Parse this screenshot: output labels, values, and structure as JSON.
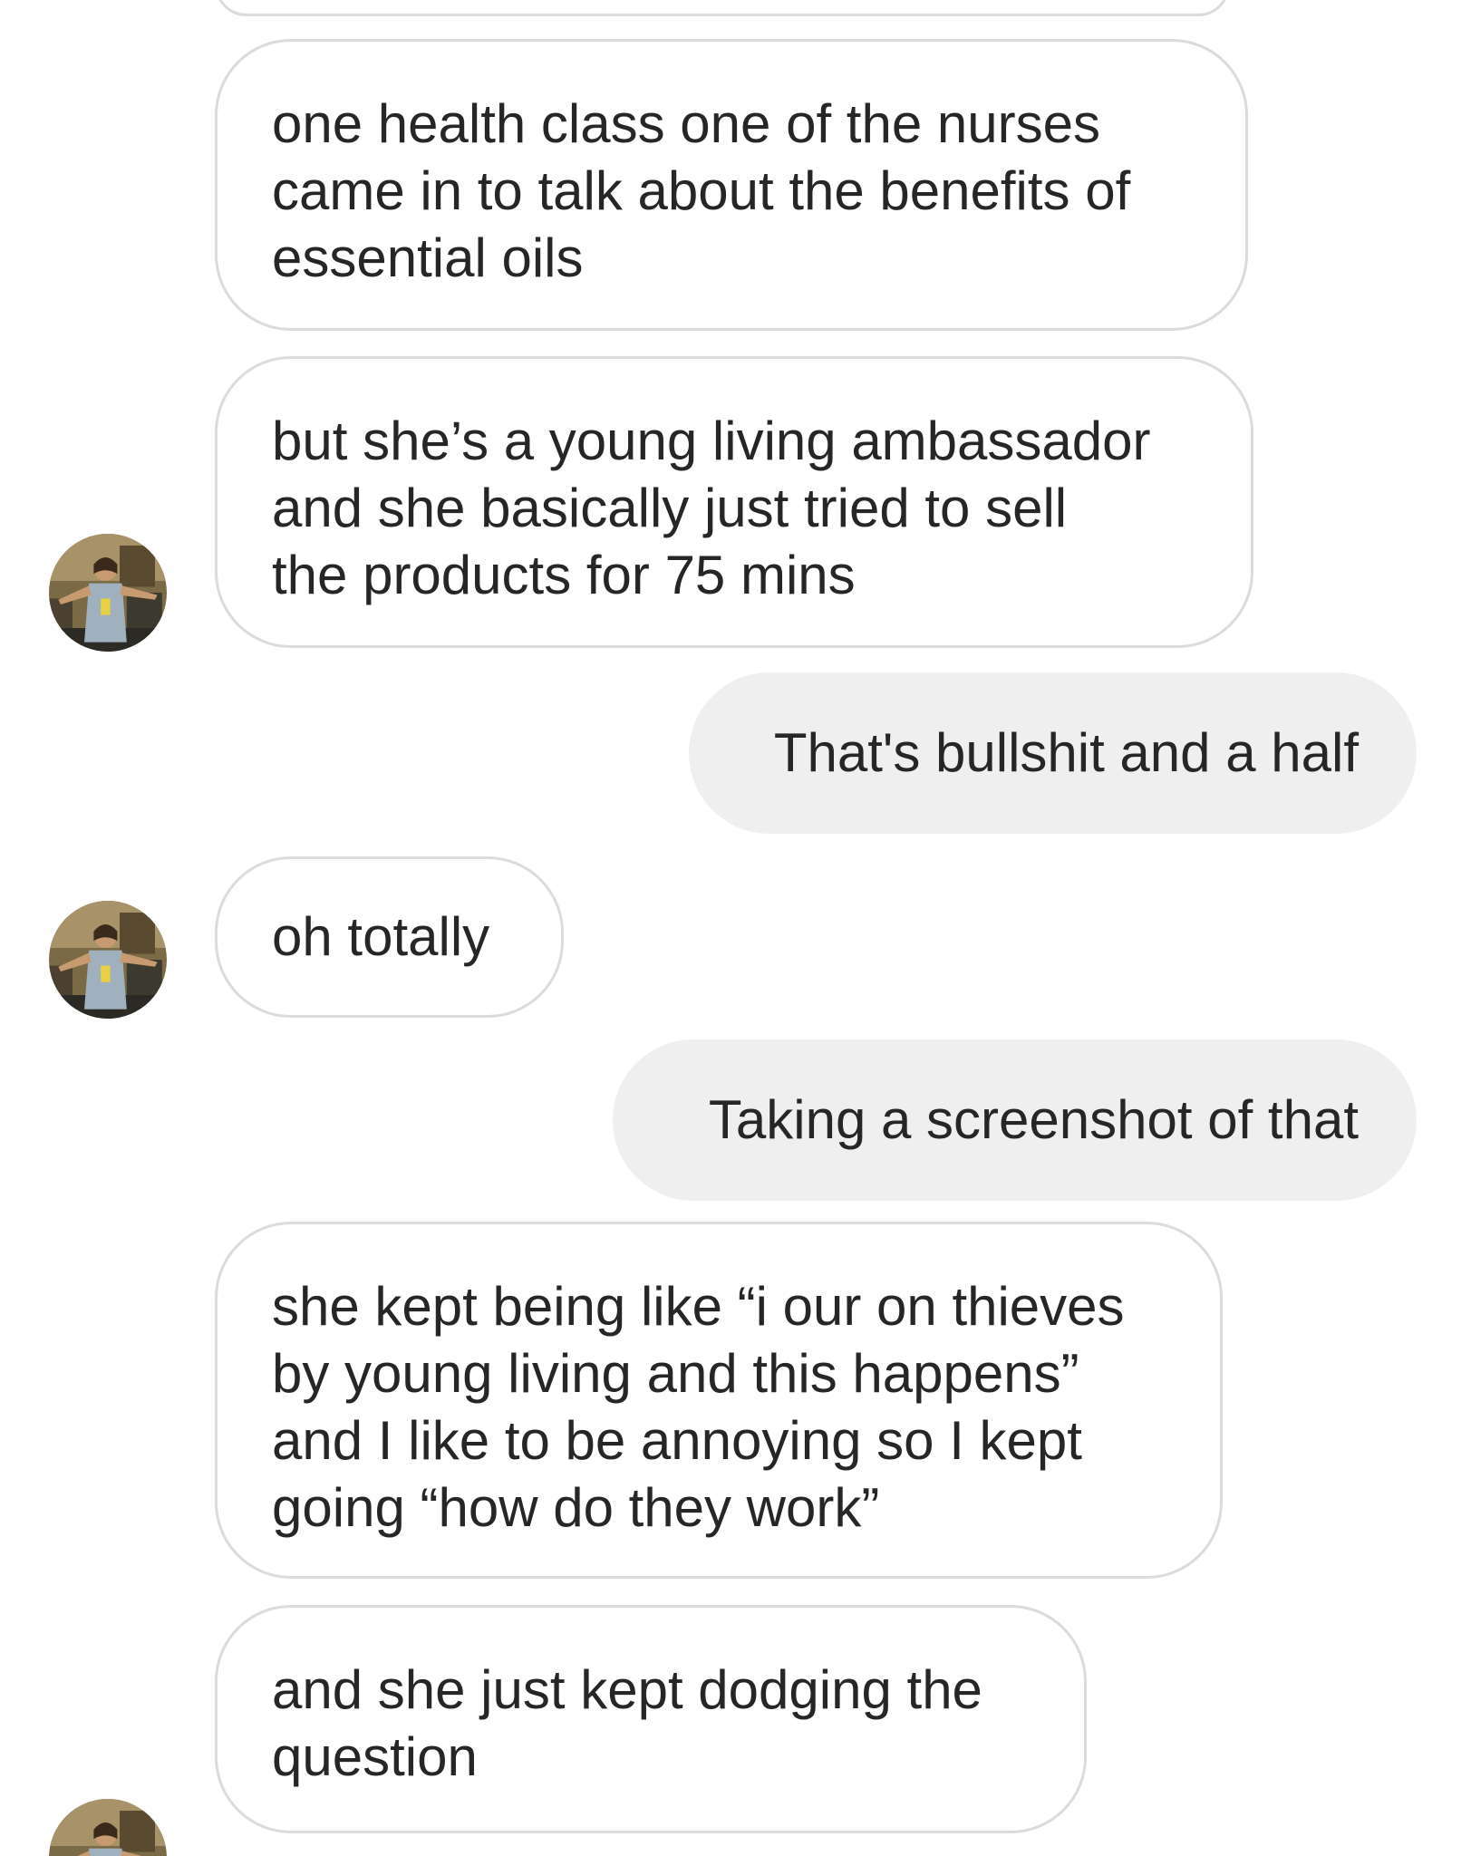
{
  "messages": [
    {
      "sender": "them",
      "text": "one health class one of the nurses\ncame in to talk about the benefits of\nessential oils"
    },
    {
      "sender": "them",
      "text": "but she’s a young living ambassador\nand she basically just tried to sell\nthe products for 75 mins"
    },
    {
      "sender": "me",
      "text": "That's bullshit and a half"
    },
    {
      "sender": "them",
      "text": "oh totally"
    },
    {
      "sender": "me",
      "text": "Taking a screenshot of that"
    },
    {
      "sender": "them",
      "text": "she kept being like “i our on thieves\nby young living and this happens”\nand I like to be annoying so I kept\ngoing “how do they work”"
    },
    {
      "sender": "them",
      "text": "and she just kept dodging the\nquestion"
    }
  ],
  "colors": {
    "incoming_border": "#dbdbdb",
    "outgoing_bg": "#efefef",
    "text": "#262626"
  },
  "icons": {
    "avatar": "profile-photo-avatar"
  }
}
